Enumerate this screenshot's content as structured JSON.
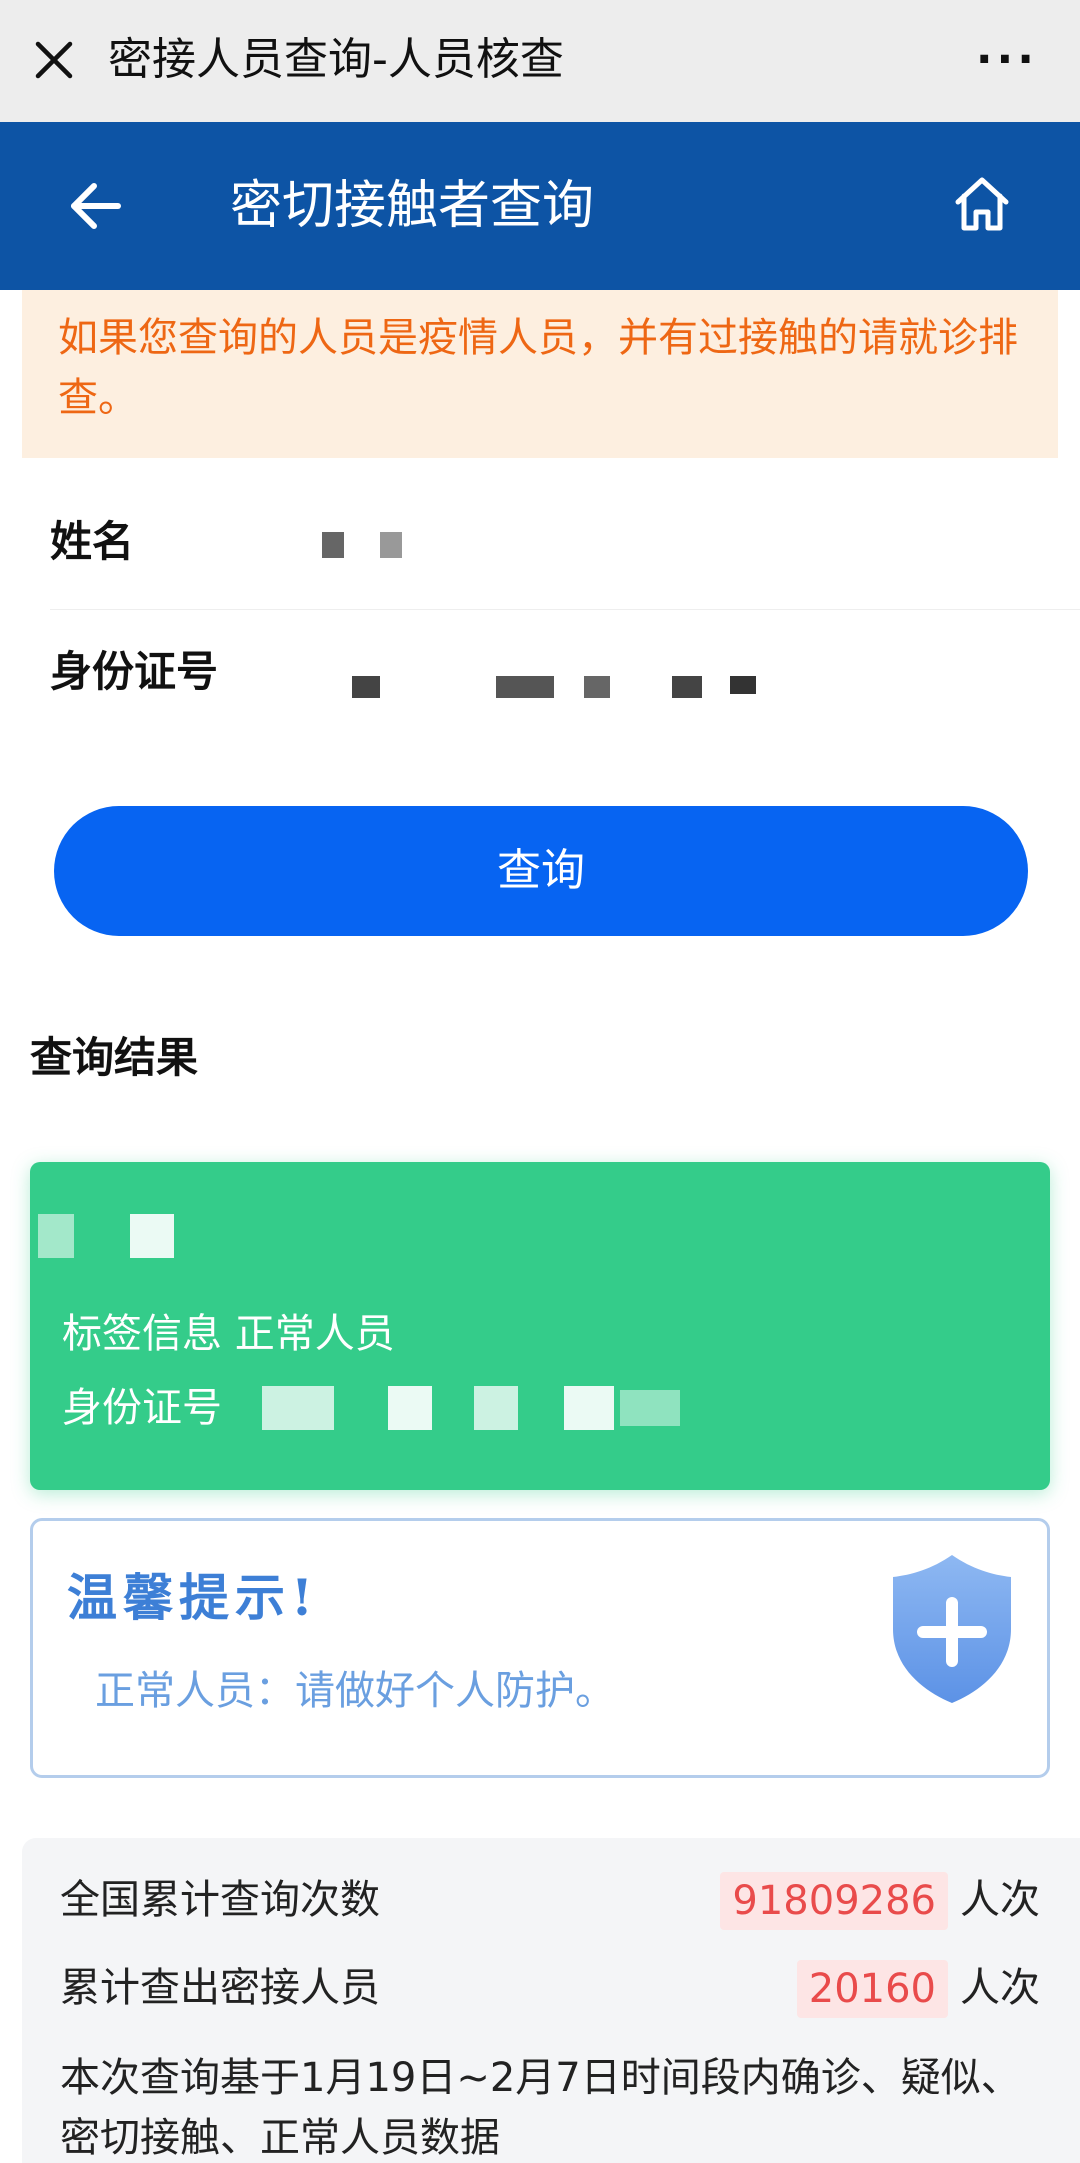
{
  "window": {
    "title": "密接人员查询-人员核查",
    "more": "···"
  },
  "nav": {
    "title": "密切接触者查询"
  },
  "warning": {
    "text": "如果您查询的人员是疫情人员，并有过接触的请就诊排查。"
  },
  "form": {
    "name_label": "姓名",
    "id_label": "身份证号",
    "query_button": "查询"
  },
  "result": {
    "section_title": "查询结果",
    "tag_line": "标签信息 正常人员",
    "id_label": "身份证号"
  },
  "tip": {
    "title": "温馨提示!",
    "text": "正常人员：请做好个人防护。"
  },
  "stats": {
    "total_queries_label": "全国累计查询次数",
    "total_queries_value": "91809286",
    "total_queries_unit": "人次",
    "contacts_label": "累计查出密接人员",
    "contacts_value": "20160",
    "contacts_unit": "人次",
    "note": "本次查询基于1月19日~2月7日时间段内确诊、疑似、密切接触、正常人员数据"
  },
  "colors": {
    "nav_blue": "#0d54a5",
    "button_blue": "#0764f2",
    "result_green": "#34cc8a",
    "warning_orange": "#ee6714",
    "stat_red": "#e94b4b"
  },
  "icons": [
    "close-icon",
    "more-icon",
    "back-arrow-icon",
    "home-icon",
    "shield-plus-icon"
  ]
}
